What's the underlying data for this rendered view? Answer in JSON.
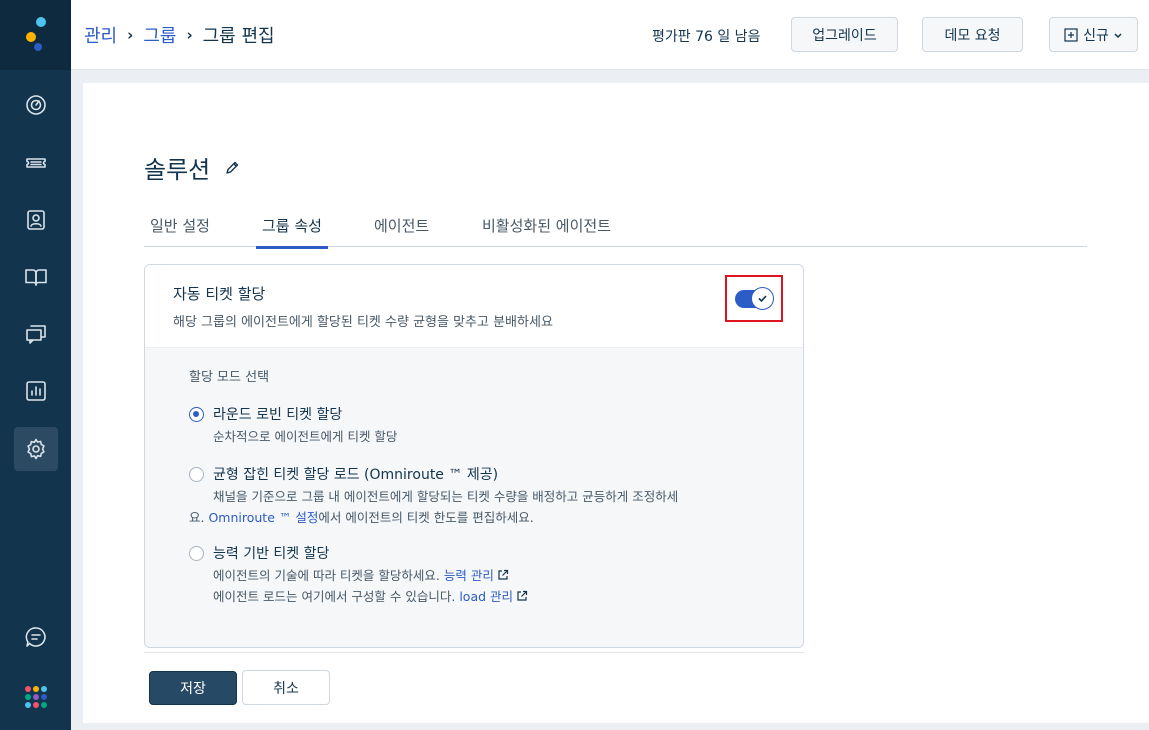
{
  "header": {
    "breadcrumb": [
      "관리",
      "그룹",
      "그룹 편집"
    ],
    "trial_text": "평가판 76 일 남음",
    "upgrade_label": "업그레이드",
    "demo_label": "데모 요청",
    "new_label": "신규"
  },
  "sidebar": {
    "items": [
      {
        "icon": "dashboard-icon"
      },
      {
        "icon": "ticket-icon"
      },
      {
        "icon": "contacts-icon"
      },
      {
        "icon": "book-icon"
      },
      {
        "icon": "chat-icon"
      },
      {
        "icon": "reports-icon"
      },
      {
        "icon": "gear-icon",
        "active": true
      },
      {
        "icon": "chat-bubble-icon"
      }
    ]
  },
  "page": {
    "title": "솔루션",
    "tabs": [
      "일반 설정",
      "그룹 속성",
      "에이전트",
      "비활성화된 에이전트"
    ],
    "active_tab": "그룹 속성"
  },
  "card": {
    "title": "자동 티켓 할당",
    "description": "해당 그룹의 에이전트에게 할당된 티켓 수량 균형을 맞추고 분배하세요",
    "toggle_on": true,
    "mode_label": "할당 모드 선택",
    "options": [
      {
        "title": "라운드 로빈 티켓 할당",
        "desc": "순차적으로 에이전트에게 티켓 할당",
        "checked": true
      },
      {
        "title": "균형 잡힌 티켓 할당 로드 (Omniroute ™ 제공)",
        "desc_line1": "채널을 기준으로 그룹 내 에이전트에게 할당되는 티켓 수량을 배정하고 균등하게 조정하세",
        "desc_line2_pre": "요. ",
        "desc_link": "Omniroute ™ 설정",
        "desc_line2_post": "에서 에이전트의 티켓 한도를 편집하세요.",
        "checked": false
      },
      {
        "title": "능력 기반 티켓 할당",
        "desc_line1_pre": "에이전트의 기술에 따라 티켓을 할당하세요. ",
        "desc_link1": "능력 관리",
        "desc_line2_pre": "에이전트 로드는 여기에서 구성할 수 있습니다. ",
        "desc_link2": "load 관리",
        "checked": false
      }
    ]
  },
  "footer": {
    "save_label": "저장",
    "cancel_label": "취소"
  },
  "colors": {
    "sidebar": "#12344d",
    "accent": "#2c5cc5",
    "highlight_box": "#e0141e"
  }
}
